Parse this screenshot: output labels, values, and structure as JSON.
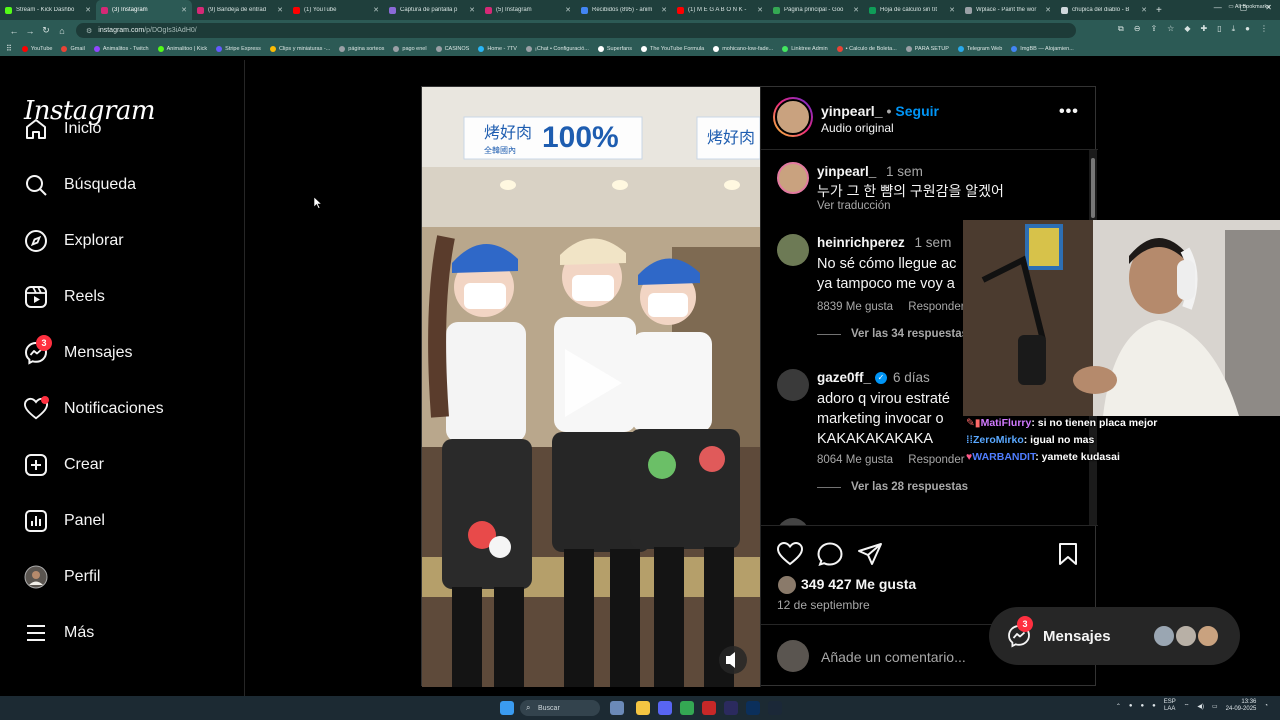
{
  "browser": {
    "tabs": [
      {
        "label": "Stream - Kick Dashbo",
        "color": "#53fc18"
      },
      {
        "label": "(3) Instagram",
        "color": "#d62976",
        "active": true
      },
      {
        "label": "(9) Bandeja de entrad",
        "color": "#d62976"
      },
      {
        "label": "(1) YouTube",
        "color": "#ff0000"
      },
      {
        "label": "Captura de pantalla p",
        "color": "#8a6ad8"
      },
      {
        "label": "(5) Instagram",
        "color": "#d62976"
      },
      {
        "label": "Recibidos (895) - anim",
        "color": "#4285f4"
      },
      {
        "label": "(1) M E G A B O N K -",
        "color": "#ff0000"
      },
      {
        "label": "Página principal - Goo",
        "color": "#34a853"
      },
      {
        "label": "Hoja de cálculo sin tít",
        "color": "#0f9d58"
      },
      {
        "label": "Wplace - Paint the wor",
        "color": "#9aa0a6"
      },
      {
        "label": "chupica del diablo - B",
        "color": "#cfd8dc"
      }
    ],
    "new_tab": "+",
    "url_host": "instagram.com",
    "url_path": "/p/DOgIs3iAdH0/",
    "bookmarks": [
      {
        "label": "YouTube",
        "color": "#ff0000"
      },
      {
        "label": "Gmail",
        "color": "#ea4335"
      },
      {
        "label": "Animalitos - Twitch",
        "color": "#9146ff"
      },
      {
        "label": "Animalitoo | Kick",
        "color": "#53fc18"
      },
      {
        "label": "Stripe Express",
        "color": "#635bff"
      },
      {
        "label": "Clips y miniaturas -...",
        "color": "#fbbc04"
      },
      {
        "label": "página sorteos",
        "color": "#9aa0a6"
      },
      {
        "label": "pago enel",
        "color": "#9aa0a6"
      },
      {
        "label": "CASINOS",
        "color": "#9aa0a6"
      },
      {
        "label": "Home - 7TV",
        "color": "#29b6f6"
      },
      {
        "label": "¡Chat • Configuració...",
        "color": "#9aa0a6"
      },
      {
        "label": "Superfans",
        "color": "#ffffff"
      },
      {
        "label": "The YouTube Formula",
        "color": "#ffffff"
      },
      {
        "label": "mohicano-low-fade...",
        "color": "#ffffff"
      },
      {
        "label": "Linktree Admin",
        "color": "#43e660"
      },
      {
        "label": "• Calculo de Boleta...",
        "color": "#ea4335"
      },
      {
        "label": "PARA SETUP",
        "color": "#9aa0a6"
      },
      {
        "label": "Telegram Web",
        "color": "#29a9eb"
      },
      {
        "label": "ImgBB — Alojamien...",
        "color": "#4285f4"
      }
    ],
    "all_bookmarks": "All Bookmarks"
  },
  "sidebar": {
    "logo": "Instagram",
    "items": [
      {
        "label": "Inicio",
        "icon": "home-icon"
      },
      {
        "label": "Búsqueda",
        "icon": "search-icon"
      },
      {
        "label": "Explorar",
        "icon": "compass-icon"
      },
      {
        "label": "Reels",
        "icon": "reels-icon"
      },
      {
        "label": "Mensajes",
        "icon": "messenger-icon",
        "badge": "3"
      },
      {
        "label": "Notificaciones",
        "icon": "heart-icon"
      },
      {
        "label": "Crear",
        "icon": "plus-square-icon"
      },
      {
        "label": "Panel",
        "icon": "chart-icon"
      },
      {
        "label": "Perfil",
        "icon": "avatar-icon"
      },
      {
        "label": "Más",
        "icon": "menu-icon"
      }
    ]
  },
  "post": {
    "sign_left": "烤好肉",
    "sign_center": "100%",
    "sign_sub": "全韓國內",
    "sign_right": "烤好肉",
    "author": "yinpearl_",
    "follow": "Seguir",
    "separator": "•",
    "audio": "Audio original",
    "caption": {
      "author": "yinpearl_",
      "time": "1 sem",
      "text": "누가 그 한 뺨의 구원감을 알겠어",
      "translate": "Ver traducción"
    },
    "comments": [
      {
        "author": "heinrichperez",
        "time": "1 sem",
        "lines": [
          "No sé cómo llegue ac",
          "ya tampoco me voy a"
        ],
        "likes": "8839 Me gusta",
        "reply": "Responder",
        "replies": "Ver las 34 respuestas"
      },
      {
        "author": "gaze0ff_",
        "time": "6 días",
        "lines": [
          "adoro q virou estraté",
          "marketing invocar o",
          "KAKAKAKAKAKA"
        ],
        "likes": "8064 Me gusta",
        "reply": "Responder",
        "replies": "Ver las 28 respuestas"
      }
    ],
    "likes_count": "349 427 Me gusta",
    "date": "12 de septiembre",
    "comment_placeholder": "Añade un comentario..."
  },
  "chat": [
    {
      "user": "MatiFlurry",
      "msg": ": si no tienen placa mejor",
      "color": "#d17aff"
    },
    {
      "user": "ZeroMirko",
      "msg": ": igual no mas",
      "color": "#5aa8ff"
    },
    {
      "user": "WARBANDIT",
      "msg": ": yamete kudasai",
      "color": "#4f7dff"
    }
  ],
  "messages_pill": {
    "label": "Mensajes",
    "badge": "3"
  },
  "taskbar": {
    "search": "Buscar",
    "lang": "ESP",
    "lang2": "LAA",
    "time": "13:36",
    "date": "24-09-2025"
  }
}
